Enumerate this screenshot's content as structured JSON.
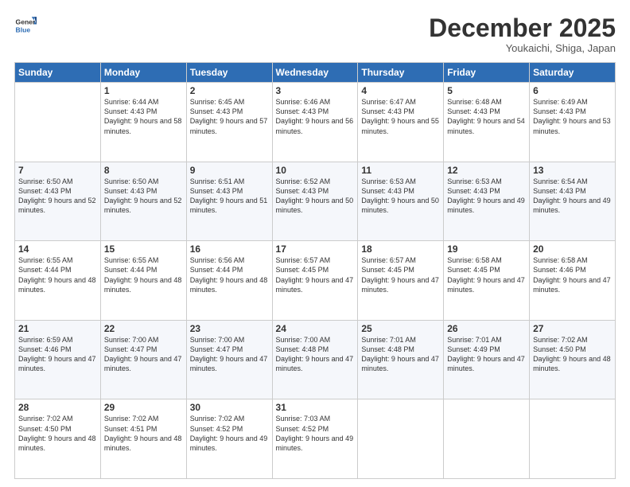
{
  "header": {
    "logo_line1": "General",
    "logo_line2": "Blue",
    "month": "December 2025",
    "location": "Youkaichi, Shiga, Japan"
  },
  "weekdays": [
    "Sunday",
    "Monday",
    "Tuesday",
    "Wednesday",
    "Thursday",
    "Friday",
    "Saturday"
  ],
  "weeks": [
    [
      null,
      {
        "day": 1,
        "sunrise": "6:44 AM",
        "sunset": "4:43 PM",
        "daylight": "9 hours and 58 minutes."
      },
      {
        "day": 2,
        "sunrise": "6:45 AM",
        "sunset": "4:43 PM",
        "daylight": "9 hours and 57 minutes."
      },
      {
        "day": 3,
        "sunrise": "6:46 AM",
        "sunset": "4:43 PM",
        "daylight": "9 hours and 56 minutes."
      },
      {
        "day": 4,
        "sunrise": "6:47 AM",
        "sunset": "4:43 PM",
        "daylight": "9 hours and 55 minutes."
      },
      {
        "day": 5,
        "sunrise": "6:48 AM",
        "sunset": "4:43 PM",
        "daylight": "9 hours and 54 minutes."
      },
      {
        "day": 6,
        "sunrise": "6:49 AM",
        "sunset": "4:43 PM",
        "daylight": "9 hours and 53 minutes."
      }
    ],
    [
      {
        "day": 7,
        "sunrise": "6:50 AM",
        "sunset": "4:43 PM",
        "daylight": "9 hours and 52 minutes."
      },
      {
        "day": 8,
        "sunrise": "6:50 AM",
        "sunset": "4:43 PM",
        "daylight": "9 hours and 52 minutes."
      },
      {
        "day": 9,
        "sunrise": "6:51 AM",
        "sunset": "4:43 PM",
        "daylight": "9 hours and 51 minutes."
      },
      {
        "day": 10,
        "sunrise": "6:52 AM",
        "sunset": "4:43 PM",
        "daylight": "9 hours and 50 minutes."
      },
      {
        "day": 11,
        "sunrise": "6:53 AM",
        "sunset": "4:43 PM",
        "daylight": "9 hours and 50 minutes."
      },
      {
        "day": 12,
        "sunrise": "6:53 AM",
        "sunset": "4:43 PM",
        "daylight": "9 hours and 49 minutes."
      },
      {
        "day": 13,
        "sunrise": "6:54 AM",
        "sunset": "4:43 PM",
        "daylight": "9 hours and 49 minutes."
      }
    ],
    [
      {
        "day": 14,
        "sunrise": "6:55 AM",
        "sunset": "4:44 PM",
        "daylight": "9 hours and 48 minutes."
      },
      {
        "day": 15,
        "sunrise": "6:55 AM",
        "sunset": "4:44 PM",
        "daylight": "9 hours and 48 minutes."
      },
      {
        "day": 16,
        "sunrise": "6:56 AM",
        "sunset": "4:44 PM",
        "daylight": "9 hours and 48 minutes."
      },
      {
        "day": 17,
        "sunrise": "6:57 AM",
        "sunset": "4:45 PM",
        "daylight": "9 hours and 47 minutes."
      },
      {
        "day": 18,
        "sunrise": "6:57 AM",
        "sunset": "4:45 PM",
        "daylight": "9 hours and 47 minutes."
      },
      {
        "day": 19,
        "sunrise": "6:58 AM",
        "sunset": "4:45 PM",
        "daylight": "9 hours and 47 minutes."
      },
      {
        "day": 20,
        "sunrise": "6:58 AM",
        "sunset": "4:46 PM",
        "daylight": "9 hours and 47 minutes."
      }
    ],
    [
      {
        "day": 21,
        "sunrise": "6:59 AM",
        "sunset": "4:46 PM",
        "daylight": "9 hours and 47 minutes."
      },
      {
        "day": 22,
        "sunrise": "7:00 AM",
        "sunset": "4:47 PM",
        "daylight": "9 hours and 47 minutes."
      },
      {
        "day": 23,
        "sunrise": "7:00 AM",
        "sunset": "4:47 PM",
        "daylight": "9 hours and 47 minutes."
      },
      {
        "day": 24,
        "sunrise": "7:00 AM",
        "sunset": "4:48 PM",
        "daylight": "9 hours and 47 minutes."
      },
      {
        "day": 25,
        "sunrise": "7:01 AM",
        "sunset": "4:48 PM",
        "daylight": "9 hours and 47 minutes."
      },
      {
        "day": 26,
        "sunrise": "7:01 AM",
        "sunset": "4:49 PM",
        "daylight": "9 hours and 47 minutes."
      },
      {
        "day": 27,
        "sunrise": "7:02 AM",
        "sunset": "4:50 PM",
        "daylight": "9 hours and 48 minutes."
      }
    ],
    [
      {
        "day": 28,
        "sunrise": "7:02 AM",
        "sunset": "4:50 PM",
        "daylight": "9 hours and 48 minutes."
      },
      {
        "day": 29,
        "sunrise": "7:02 AM",
        "sunset": "4:51 PM",
        "daylight": "9 hours and 48 minutes."
      },
      {
        "day": 30,
        "sunrise": "7:02 AM",
        "sunset": "4:52 PM",
        "daylight": "9 hours and 49 minutes."
      },
      {
        "day": 31,
        "sunrise": "7:03 AM",
        "sunset": "4:52 PM",
        "daylight": "9 hours and 49 minutes."
      },
      null,
      null,
      null
    ]
  ]
}
